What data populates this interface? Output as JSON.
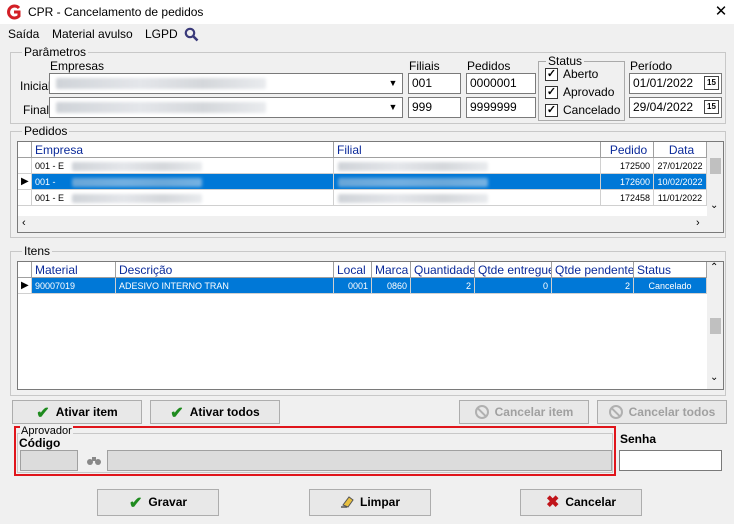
{
  "window": {
    "title": "CPR - Cancelamento de pedidos",
    "close_glyph": "✕"
  },
  "menu": [
    {
      "label": "Saída"
    },
    {
      "label": "Material avulso"
    },
    {
      "label": "LGPD"
    }
  ],
  "parametros": {
    "group_label": "Parâmetros",
    "empresas_label": "Empresas",
    "inicial_label": "Inicial",
    "final_label": "Final",
    "filiais_label": "Filiais",
    "filial_inicial": "001",
    "filial_final": "999",
    "pedidos_label": "Pedidos",
    "pedido_inicial": "0000001",
    "pedido_final": "9999999",
    "status_label": "Status",
    "status": [
      {
        "label": "Aberto",
        "checked": true
      },
      {
        "label": "Aprovado",
        "checked": true
      },
      {
        "label": "Cancelado",
        "checked": true
      }
    ],
    "periodo_label": "Período",
    "data_inicial": "01/01/2022",
    "data_final": "29/04/2022",
    "cal_glyph": "15"
  },
  "pedidos": {
    "group_label": "Pedidos",
    "columns": [
      "Empresa",
      "Filial",
      "Pedido",
      "Data"
    ],
    "rows": [
      {
        "empresa": "001 - E",
        "pedido": "172500",
        "data": "27/01/2022",
        "selected": false
      },
      {
        "empresa": "001 - ",
        "pedido": "172600",
        "data": "10/02/2022",
        "selected": true
      },
      {
        "empresa": "001 - E",
        "pedido": "172458",
        "data": "11/01/2022",
        "selected": false
      }
    ]
  },
  "itens": {
    "group_label": "Itens",
    "columns": [
      "Material",
      "Descrição",
      "Local",
      "Marca",
      "Quantidade",
      "Qtde entregue",
      "Qtde pendente",
      "Status"
    ],
    "rows": [
      {
        "material": "90007019",
        "descricao": "ADESIVO INTERNO TRAN",
        "local": "0001",
        "marca": "0860",
        "quantidade": "2",
        "entregue": "0",
        "pendente": "2",
        "status": "Cancelado",
        "selected": true
      }
    ]
  },
  "actions": {
    "ativar_item": "Ativar item",
    "ativar_todos": "Ativar todos",
    "cancelar_item": "Cancelar item",
    "cancelar_todos": "Cancelar todos"
  },
  "aprovador": {
    "group_label": "Aprovador",
    "codigo_label": "Código",
    "senha_label": "Senha",
    "highlight_color": "#e0151b"
  },
  "footer": {
    "gravar": "Gravar",
    "limpar": "Limpar",
    "cancelar": "Cancelar"
  },
  "colors": {
    "selection": "#0078d7",
    "header_text": "#0b2a9a",
    "logo": "#d31f26"
  }
}
